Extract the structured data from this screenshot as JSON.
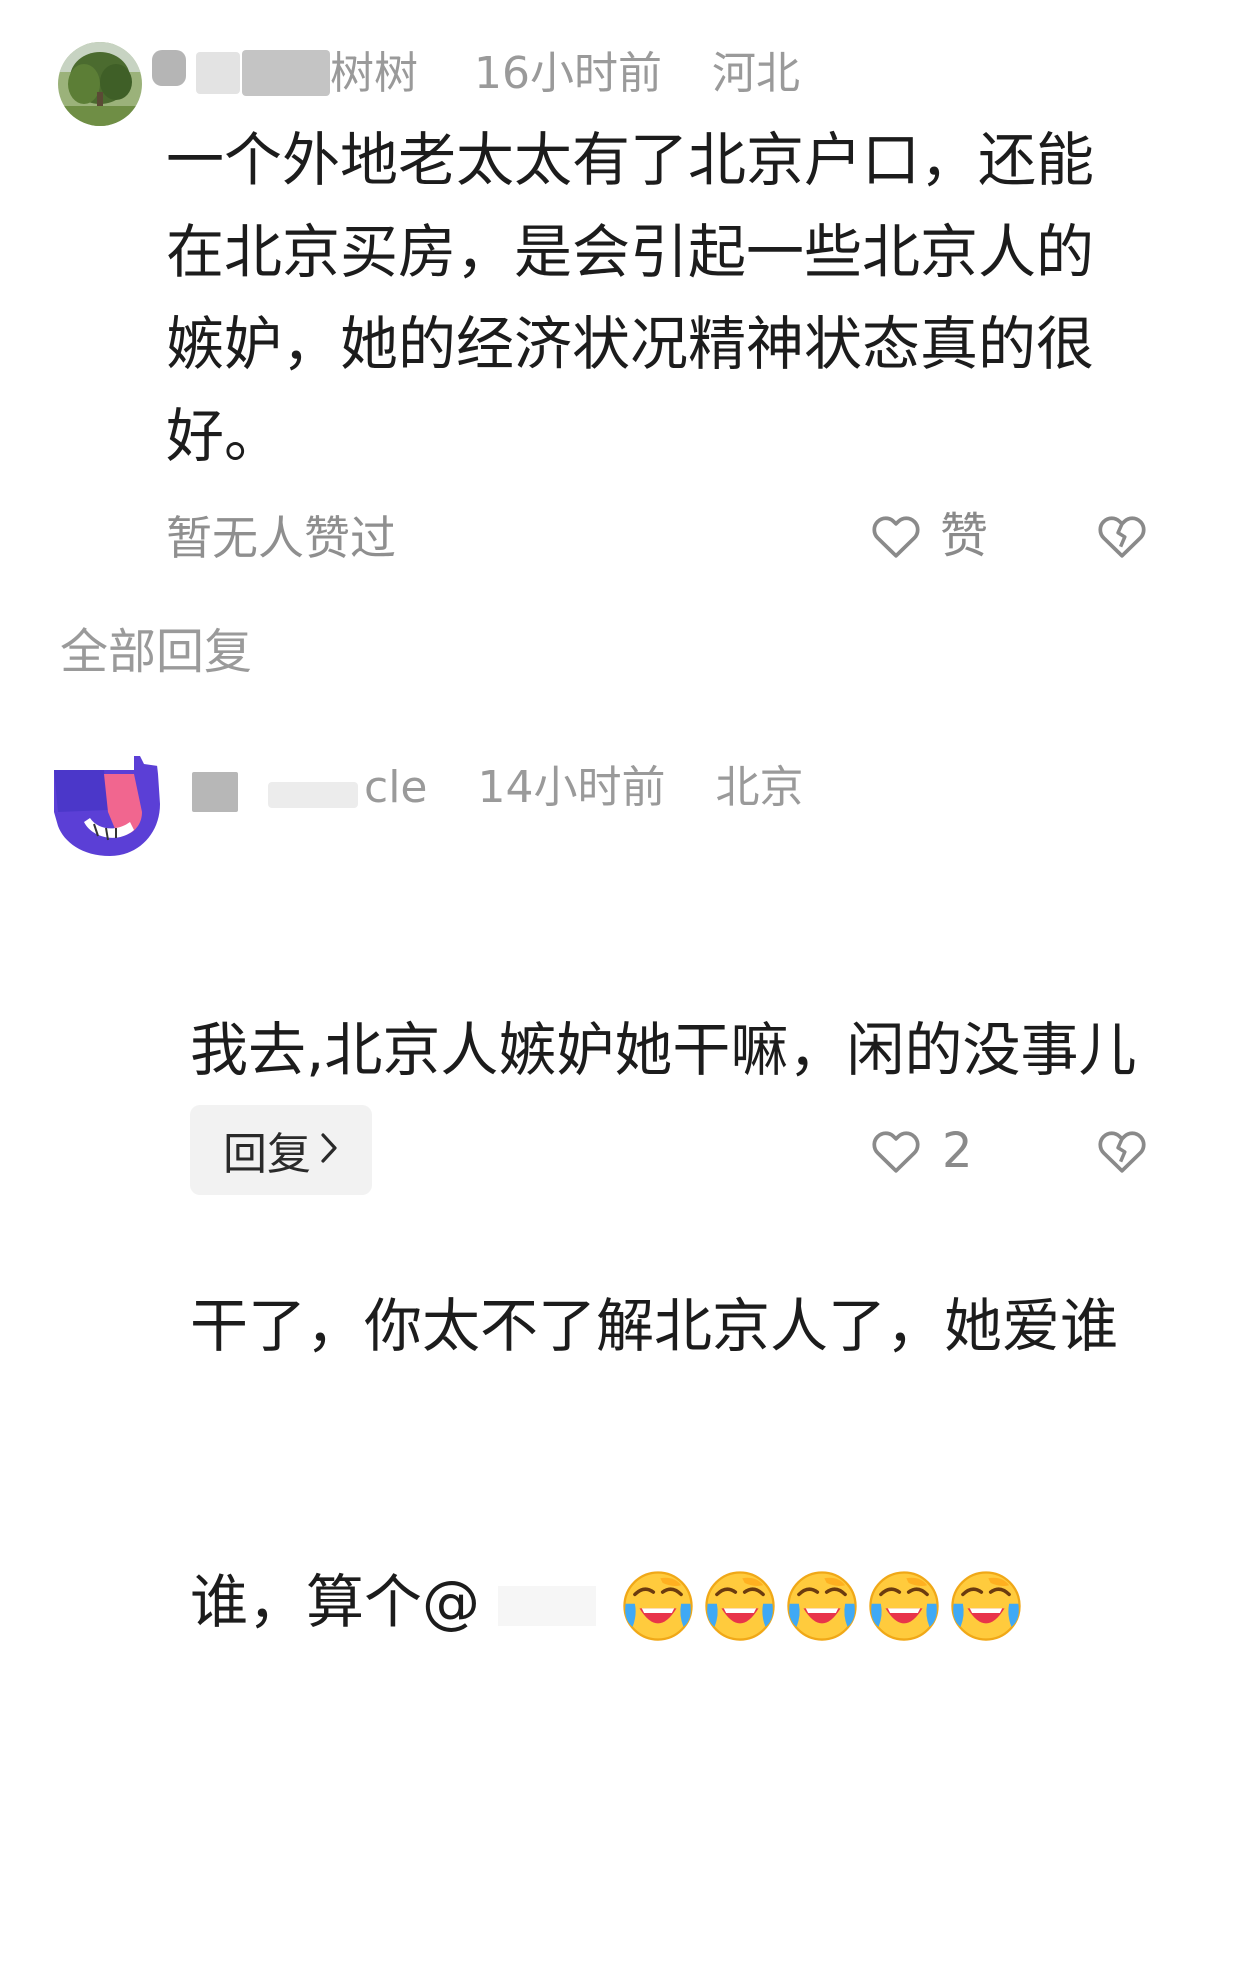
{
  "comment1": {
    "username_visible": "树树",
    "time": "16小时前",
    "location": "河北",
    "text": "一个外地老太太有了北京户口，还能\n在北京买房，是会引起一些北京人的\n嫉妒，她的经济状况精神状态真的很\n好。",
    "likes_text": "暂无人赞过",
    "like_label": "赞",
    "icons": [
      "heart-outline-icon",
      "broken-heart-icon"
    ]
  },
  "section": {
    "title": "全部回复"
  },
  "comment2": {
    "username_visible": "cle",
    "time": "14小时前",
    "location": "北京",
    "text_line1": "我去,北京人嫉妒她干嘛，闲的没事儿",
    "text_line2": "干了，你太不了解北京人了，她爱谁",
    "text_line3": "谁，算个@",
    "emoji_count": 5,
    "emoji_name": "laughing-crying-emoji",
    "reply_label": "回复",
    "like_count": "2",
    "icons": [
      "heart-outline-icon",
      "broken-heart-icon",
      "chevron-right-icon"
    ]
  },
  "colors": {
    "meta_gray": "#9a9a9a",
    "text_dark": "#1c1c1c",
    "reply_bg": "#f2f2f2"
  }
}
